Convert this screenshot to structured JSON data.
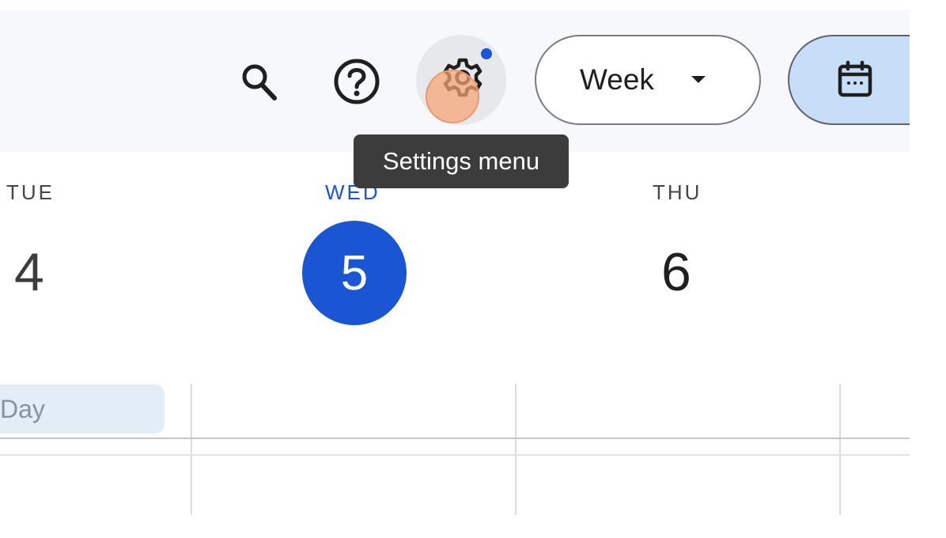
{
  "toolbar": {
    "search_icon": "search-icon",
    "help_icon": "help-icon",
    "settings_icon": "gear-icon",
    "view_selector": {
      "selected": "Week"
    },
    "calendar_icon": "calendar-icon"
  },
  "tooltip": {
    "text": "Settings menu"
  },
  "days": [
    {
      "name": "TUE",
      "number": "4"
    },
    {
      "name": "WED",
      "number": "5"
    },
    {
      "name": "THU",
      "number": "6"
    }
  ],
  "all_day": {
    "label": "Day"
  },
  "colors": {
    "accent": "#1a55d4",
    "header_bg": "#f6f8fc",
    "selected_toggle_bg": "#c7def9",
    "tooltip_bg": "#3c3c3c"
  }
}
